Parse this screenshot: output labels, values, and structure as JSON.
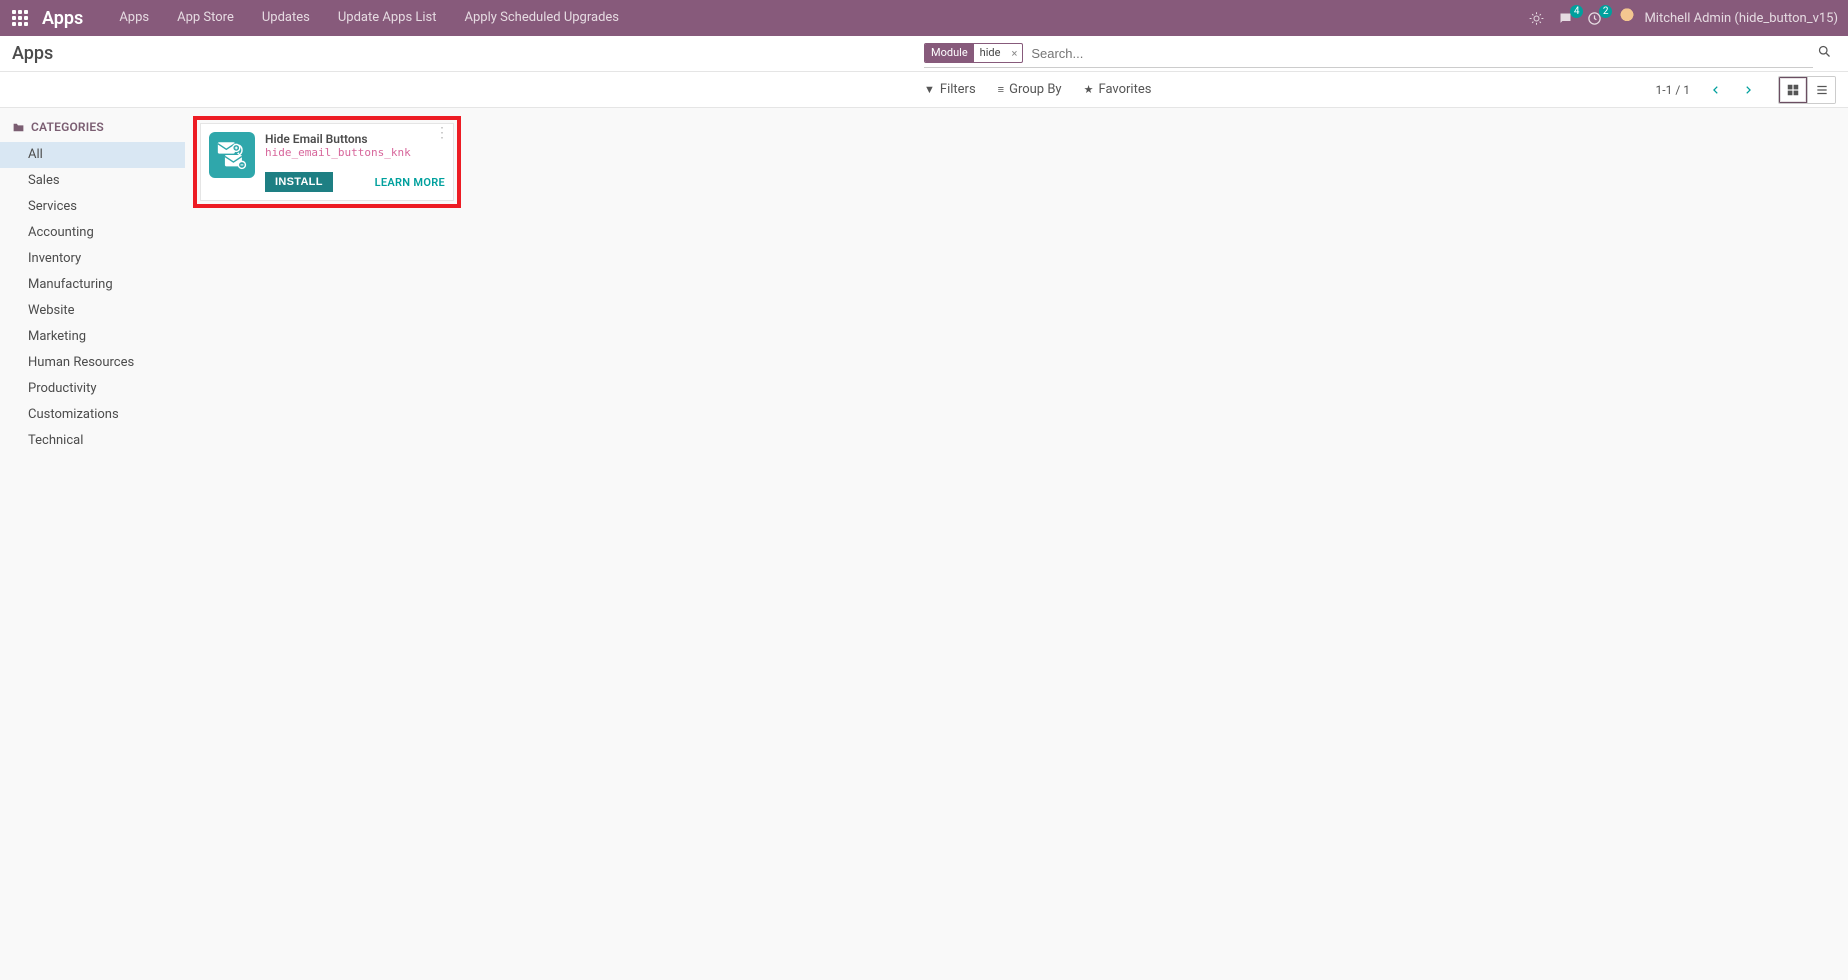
{
  "nav": {
    "brand": "Apps",
    "menus": [
      "Apps",
      "App Store",
      "Updates",
      "Update Apps List",
      "Apply Scheduled Upgrades"
    ],
    "chat_badge": "4",
    "activity_badge": "2",
    "user": "Mitchell Admin (hide_button_v15)"
  },
  "breadcrumb": "Apps",
  "search": {
    "facet_label": "Module",
    "facet_value": "hide",
    "placeholder": "Search..."
  },
  "toolbar": {
    "filters": "Filters",
    "groupby": "Group By",
    "favorites": "Favorites",
    "pager": "1-1 / 1"
  },
  "sidebar": {
    "heading": "CATEGORIES",
    "items": [
      "All",
      "Sales",
      "Services",
      "Accounting",
      "Inventory",
      "Manufacturing",
      "Website",
      "Marketing",
      "Human Resources",
      "Productivity",
      "Customizations",
      "Technical"
    ],
    "active_index": 0
  },
  "cards": [
    {
      "title": "Hide Email Buttons",
      "tech": "hide_email_buttons_knk",
      "install": "INSTALL",
      "learn": "LEARN MORE"
    }
  ]
}
